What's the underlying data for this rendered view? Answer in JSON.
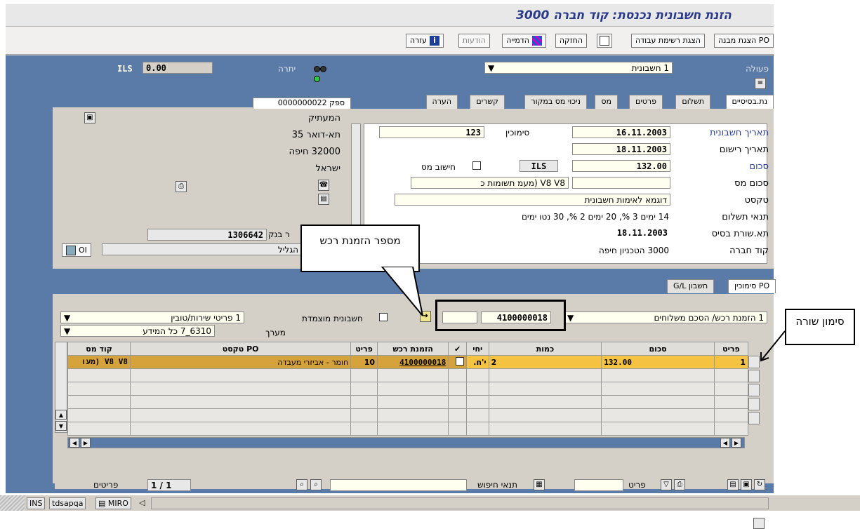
{
  "title": "הזנת חשבונית נכנסת: קוד חברה 3000",
  "toolbar": {
    "po_structure": "PO הצגת מבנה",
    "worklist": "הצגת רשימת עבודה",
    "hold": "החזקה",
    "simulate": "הדמייה",
    "messages": "הודעות",
    "help": "עזרה"
  },
  "header": {
    "action_label": "פעולה",
    "action_value": "1 חשבונית",
    "balance_label": "יתרה",
    "balance_value": "0.00",
    "balance_currency": "ILS"
  },
  "tabs": [
    "נת.בסיסיים",
    "תשלום",
    "פרטים",
    "מס",
    "ניכוי מס במקור",
    "קשרים",
    "הערה"
  ],
  "basic": {
    "invoice_date_label": "תאריך חשבונית",
    "invoice_date": "16.11.2003",
    "reference_label": "סימוכין",
    "reference": "123",
    "posting_date_label": "תאריך רישום",
    "posting_date": "18.11.2003",
    "amount_label": "סכום",
    "amount": "132.00",
    "currency": "ILS",
    "calc_tax_label": "חישוב מס",
    "tax_amount_label": "סכום מס",
    "tax_code": "V8 V8 (מעמ תשומות כ",
    "text_label": "טקסט",
    "text": "דוגמא לאימות חשבונית",
    "payterms_label": "תנאי תשלום",
    "payterms": "14 ימים 3 %, 20 ימים 2 %, 30 נטו ימים",
    "baseline_label": "תא.שורת בסיס",
    "baseline": "18.11.2003",
    "company_label": "קוד חברה",
    "company": "3000 הטכניון חיפה"
  },
  "vendor": {
    "tab_label": "ספק 0000000022",
    "name": "המעתיק",
    "street": "תא-דואר 35",
    "city": "32000 חיפה",
    "country": "ישראל",
    "bank_label": "ר בנק",
    "bank_value": "1306642",
    "bank_name": "הגליל",
    "oi_label": "OI"
  },
  "po_tabs": [
    "PO סימוכין",
    "חשבון G/L"
  ],
  "po_ref": {
    "type_value": "1 הזמנת רכש/ הסכם משלוחים",
    "po_number": "4100000018",
    "consolidated_label": "חשבונית מוצמדת",
    "layout_value": "1 פריטי שירות/טובין",
    "layout2_label": "מערך",
    "layout2_value": "6310_7 כל המידע"
  },
  "grid": {
    "columns": [
      "פריט",
      "סכום",
      "כמות",
      "יחי",
      "",
      "הזמנת רכש",
      "פריט",
      "PO טקסט",
      "קוד מס"
    ],
    "rows": [
      {
        "item": "1",
        "amount": "132.00",
        "qty": "2",
        "unit": "י'ח.",
        "po": "4100000018",
        "po_item": "10",
        "po_text": "חומר - אביזרי מעבדה",
        "tax": "V8 V8 (מעו"
      }
    ]
  },
  "bottom": {
    "item_label": "פריט",
    "search_label": "תנאי חיפוש",
    "items_label": "פריטים",
    "page": "1 / 1"
  },
  "callouts": {
    "po_number": "מספר הזמנת רכש",
    "row_mark": "סימון שורה"
  },
  "status": {
    "ins": "INS",
    "server": "tdsapqa",
    "tcode": "MIRO"
  }
}
